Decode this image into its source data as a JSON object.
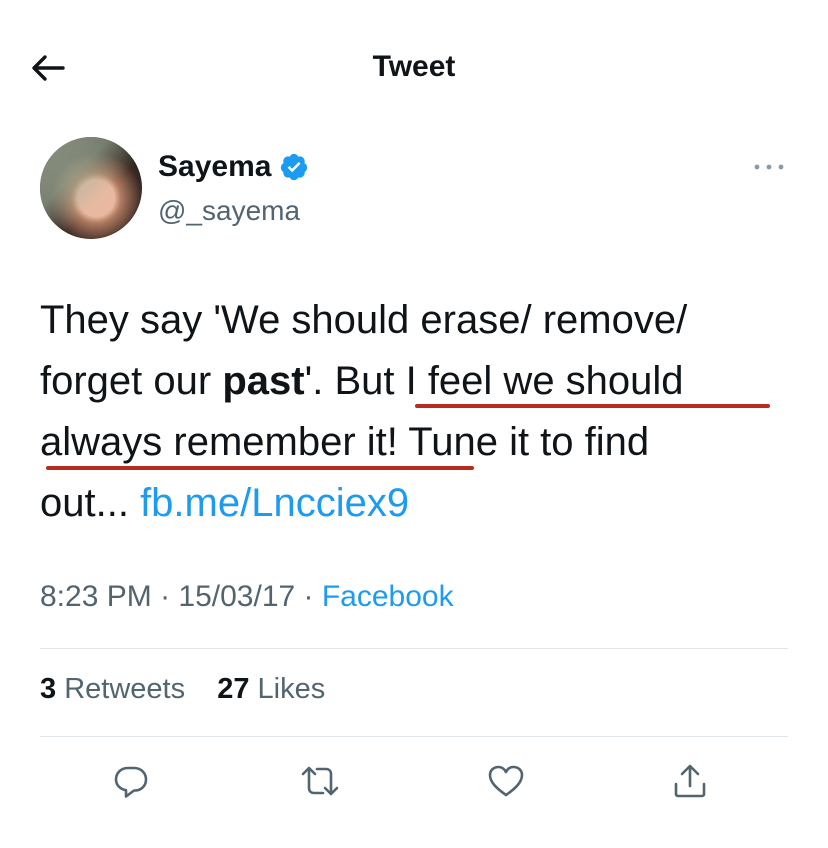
{
  "header": {
    "title": "Tweet"
  },
  "author": {
    "name": "Sayema",
    "handle": "@_sayema"
  },
  "tweet": {
    "line1": "They say 'We should erase/ remove/",
    "line2_pre": "forget our ",
    "line2_bold": "past",
    "line2_post": "'. But I feel we should",
    "line3": "always remember it! Tune it to find",
    "line4_pre": "out... ",
    "link": "fb.me/Lncciex9"
  },
  "meta": {
    "time": "8:23 PM",
    "sep1": " · ",
    "date": "15/03/17",
    "sep2": " · ",
    "source": "Facebook"
  },
  "stats": {
    "retweets_count": "3",
    "retweets_label": " Retweets",
    "likes_count": "27",
    "likes_label": " Likes"
  },
  "colors": {
    "link": "#1d9bf0",
    "annotation_underline": "#b72c1f",
    "verified": "#1d9bf0"
  },
  "icons": {
    "back": "arrow-left-icon",
    "verified": "verified-badge-icon",
    "more": "more-horizontal-icon",
    "reply": "reply-icon",
    "retweet": "retweet-icon",
    "like": "heart-icon",
    "share": "share-icon"
  }
}
